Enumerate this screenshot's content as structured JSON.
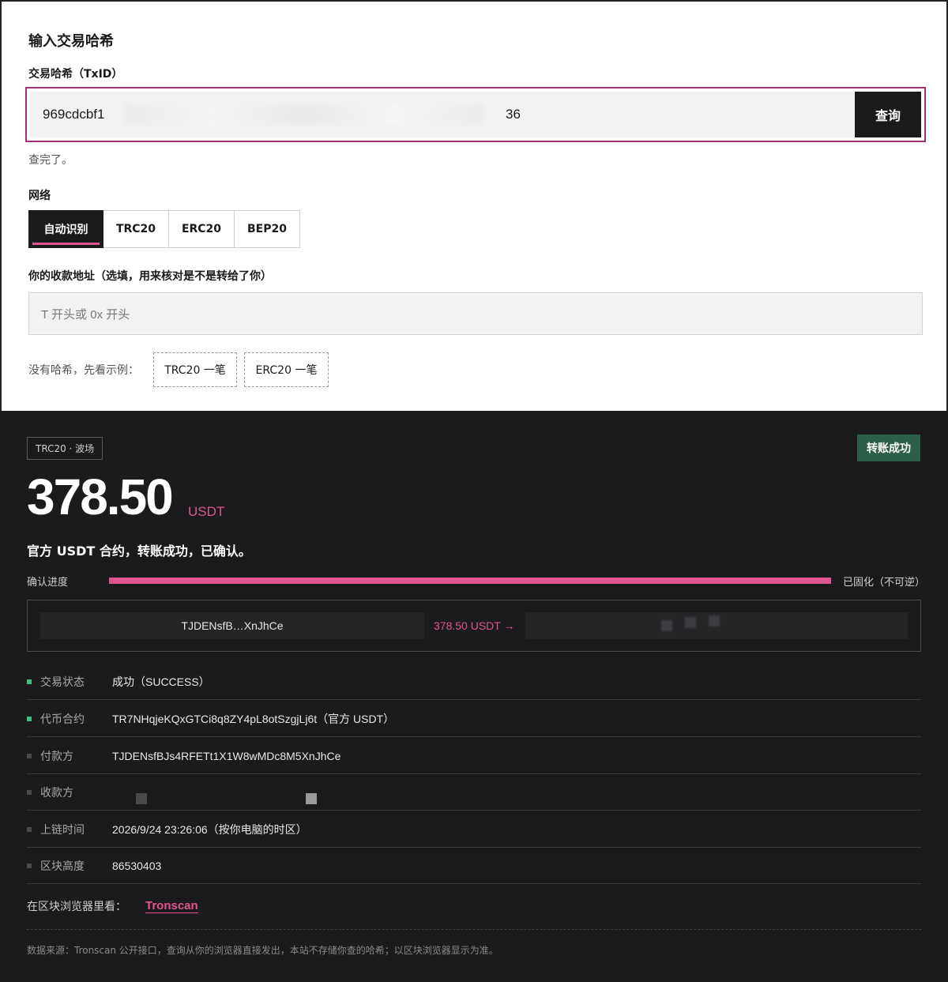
{
  "form": {
    "title": "输入交易哈希",
    "txid_label": "交易哈希（TxID）",
    "txid_value_start": "969cdcbf1",
    "txid_value_end": "36",
    "query_button": "查询",
    "status_message": "查完了。",
    "network_label": "网络",
    "network_tabs": [
      {
        "label": "自动识别",
        "active": true
      },
      {
        "label": "TRC20",
        "active": false
      },
      {
        "label": "ERC20",
        "active": false
      },
      {
        "label": "BEP20",
        "active": false
      }
    ],
    "address_label": "你的收款地址（选填，用来核对是不是转给了你）",
    "address_placeholder": "T 开头或 0x 开头",
    "example_label": "没有哈希，先看示例：",
    "example_buttons": [
      "TRC20 一笔",
      "ERC20 一笔"
    ]
  },
  "result": {
    "chain_badge": "TRC20 · 波场",
    "status_badge": "转账成功",
    "amount": "378.50",
    "unit": "USDT",
    "summary": "官方 USDT 合约，转账成功，已确认。",
    "progress_label": "确认进度",
    "progress_fraction": 1.0,
    "progress_end_label": "已固化（不可逆）",
    "flow": {
      "from": "TJDENsfB…XnJhCe",
      "amount": "378.50 USDT →"
    },
    "details": [
      {
        "key": "交易状态",
        "value": "成功（SUCCESS）",
        "ok": true
      },
      {
        "key": "代币合约",
        "value": "TR7NHqjeKQxGTCi8q8ZY4pL8otSzgjLj6t（官方 USDT）",
        "ok": true
      },
      {
        "key": "付款方",
        "value": "TJDENsfBJs4RFETt1X1W8wMDc8M5XnJhCe",
        "ok": false
      },
      {
        "key": "收款方",
        "value": "",
        "ok": false
      },
      {
        "key": "上链时间",
        "value": "2026/9/24 23:26:06（按你电脑的时区）",
        "ok": false
      },
      {
        "key": "区块高度",
        "value": "86530403",
        "ok": false
      }
    ],
    "explorer_label": "在区块浏览器里看：",
    "explorer_link": "Tronscan",
    "footnote": "数据来源：Tronscan 公开接口，查询从你的浏览器直接发出，本站不存储你查的哈希；以区块浏览器显示为准。"
  },
  "colors": {
    "accent": "#e0558f",
    "success": "#2c5f47",
    "ok_marker": "#3fbf7f",
    "dark_bg": "#1b1b1d"
  }
}
